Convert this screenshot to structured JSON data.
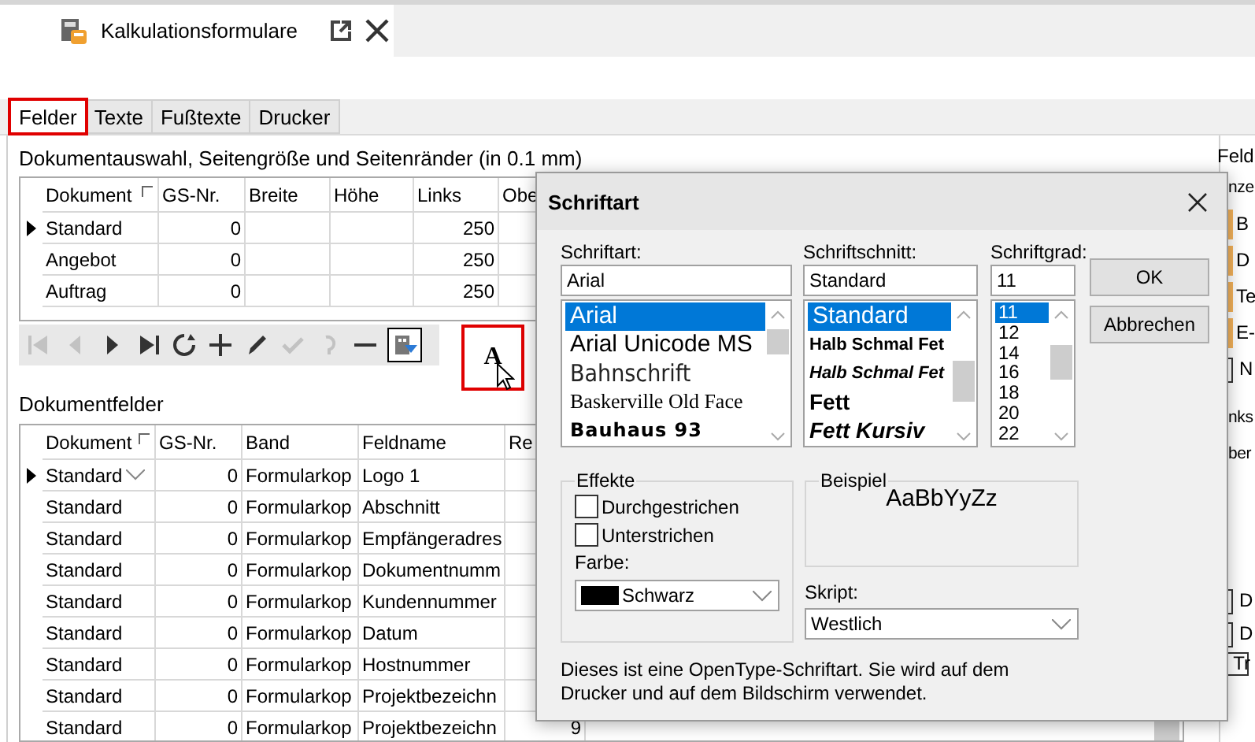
{
  "document_tab": {
    "title": "Kalkulationsformulare"
  },
  "tabs": [
    {
      "label": "Felder",
      "selected": true,
      "highlighted": true
    },
    {
      "label": "Texte",
      "selected": false,
      "highlighted": false
    },
    {
      "label": "Fußtexte",
      "selected": false,
      "highlighted": false
    },
    {
      "label": "Drucker",
      "selected": false,
      "highlighted": false
    }
  ],
  "page_section": {
    "label": "Dokumentauswahl, Seitengröße und Seitenränder (in 0.1 mm)"
  },
  "document_table": {
    "columns": [
      "Dokument",
      "GS-Nr.",
      "Breite",
      "Höhe",
      "Links",
      "Obe"
    ],
    "rows": [
      {
        "current": true,
        "dokument": "Standard",
        "gs_nr": "0",
        "links": "250"
      },
      {
        "current": false,
        "dokument": "Angebot",
        "gs_nr": "0",
        "links": "250"
      },
      {
        "current": false,
        "dokument": "Auftrag",
        "gs_nr": "0",
        "links": "250"
      }
    ]
  },
  "navigator": [
    {
      "kind": "first",
      "disabled": true
    },
    {
      "kind": "prior",
      "disabled": true
    },
    {
      "kind": "next",
      "disabled": false
    },
    {
      "kind": "last",
      "disabled": false
    },
    {
      "kind": "refresh",
      "disabled": false
    },
    {
      "kind": "insert",
      "disabled": false
    },
    {
      "kind": "edit",
      "disabled": false
    },
    {
      "kind": "post",
      "disabled": true
    },
    {
      "kind": "cancel",
      "disabled": true
    },
    {
      "kind": "delete",
      "disabled": false
    },
    {
      "kind": "filter",
      "disabled": false
    }
  ],
  "font_button": {
    "label": "A",
    "highlighted": true
  },
  "fields_section": {
    "label": "Dokumentfelder"
  },
  "fields_table": {
    "columns": [
      "Dokument",
      "GS-Nr.",
      "Band",
      "Feldname",
      "Re"
    ],
    "rows": [
      {
        "current": true,
        "dokument": "Standard",
        "gs_nr": "0",
        "band": "Formularkop",
        "feldname": "Logo 1"
      },
      {
        "current": false,
        "dokument": "Standard",
        "gs_nr": "0",
        "band": "Formularkop",
        "feldname": "Abschnitt"
      },
      {
        "current": false,
        "dokument": "Standard",
        "gs_nr": "0",
        "band": "Formularkop",
        "feldname": "Empfängeradres"
      },
      {
        "current": false,
        "dokument": "Standard",
        "gs_nr": "0",
        "band": "Formularkop",
        "feldname": "Dokumentnumm"
      },
      {
        "current": false,
        "dokument": "Standard",
        "gs_nr": "0",
        "band": "Formularkop",
        "feldname": "Kundennummer"
      },
      {
        "current": false,
        "dokument": "Standard",
        "gs_nr": "0",
        "band": "Formularkop",
        "feldname": "Datum"
      },
      {
        "current": false,
        "dokument": "Standard",
        "gs_nr": "0",
        "band": "Formularkop",
        "feldname": "Hostnummer"
      },
      {
        "current": false,
        "dokument": "Standard",
        "gs_nr": "0",
        "band": "Formularkop",
        "feldname": "Projektbezeichn"
      },
      {
        "current": false,
        "dokument": "Standard",
        "gs_nr": "0",
        "band": "Formularkop",
        "feldname": "Projektbezeichn",
        "re": "9"
      }
    ]
  },
  "right_panel": {
    "groups": [
      {
        "items": [
          {
            "kind": "heading",
            "text": "Feld"
          },
          {
            "kind": "label",
            "text": "nze"
          },
          {
            "kind": "tag",
            "text": "B"
          },
          {
            "kind": "tag",
            "text": "D"
          },
          {
            "kind": "tag",
            "text": "Te"
          },
          {
            "kind": "tag",
            "text": "E-"
          },
          {
            "kind": "check",
            "text": "N"
          }
        ]
      },
      {
        "items": [
          {
            "kind": "label",
            "text": "nks"
          },
          {
            "kind": "label",
            "text": "ber"
          }
        ]
      },
      {
        "items": [
          {
            "kind": "check",
            "text": "D"
          },
          {
            "kind": "check",
            "text": "D"
          },
          {
            "kind": "box",
            "text": "Tr"
          }
        ]
      }
    ]
  },
  "font_dialog": {
    "title": "Schriftart",
    "font": {
      "label": "Schriftart:",
      "value": "Arial",
      "options": [
        {
          "text": "Arial",
          "kind": "sans",
          "selected": true
        },
        {
          "text": "Arial Unicode MS",
          "kind": "sans",
          "selected": false
        },
        {
          "text": "Bahnschrift",
          "kind": "narrow",
          "selected": false
        },
        {
          "text": "Baskerville Old Face",
          "kind": "serif",
          "selected": false
        },
        {
          "text": "Bauhaus 93",
          "kind": "display",
          "selected": false
        }
      ]
    },
    "style": {
      "label": "Schriftschnitt:",
      "value": "Standard",
      "options": [
        {
          "text": "Standard",
          "kind": "regular",
          "selected": true
        },
        {
          "text": "Halb Schmal Fet",
          "kind": "bold",
          "selected": false
        },
        {
          "text": "Halb Schmal Fet",
          "kind": "bold-italic",
          "selected": false
        },
        {
          "text": "Fett",
          "kind": "bold",
          "selected": false
        },
        {
          "text": "Fett Kursiv",
          "kind": "bold-italic",
          "selected": false
        }
      ]
    },
    "size": {
      "label": "Schriftgrad:",
      "value": "11",
      "options": [
        {
          "text": "11",
          "selected": true
        },
        {
          "text": "12",
          "selected": false
        },
        {
          "text": "14",
          "selected": false
        },
        {
          "text": "16",
          "selected": false
        },
        {
          "text": "18",
          "selected": false
        },
        {
          "text": "20",
          "selected": false
        },
        {
          "text": "22",
          "selected": false
        }
      ]
    },
    "buttons": [
      "OK",
      "Abbrechen"
    ],
    "effects": {
      "title": "Effekte",
      "options": [
        {
          "label": "Durchgestrichen",
          "checked": false
        },
        {
          "label": "Unterstrichen",
          "checked": false
        }
      ],
      "color_label": "Farbe:",
      "color": {
        "label": "Schwarz",
        "color": "#000000"
      }
    },
    "sample": {
      "title": "Beispiel",
      "text": "AaBbYyZz"
    },
    "script": {
      "label": "Skript:",
      "value": "Westlich"
    },
    "note": "Dieses ist eine OpenType-Schriftart. Sie wird auf dem Drucker und auf dem Bildschirm verwendet."
  }
}
